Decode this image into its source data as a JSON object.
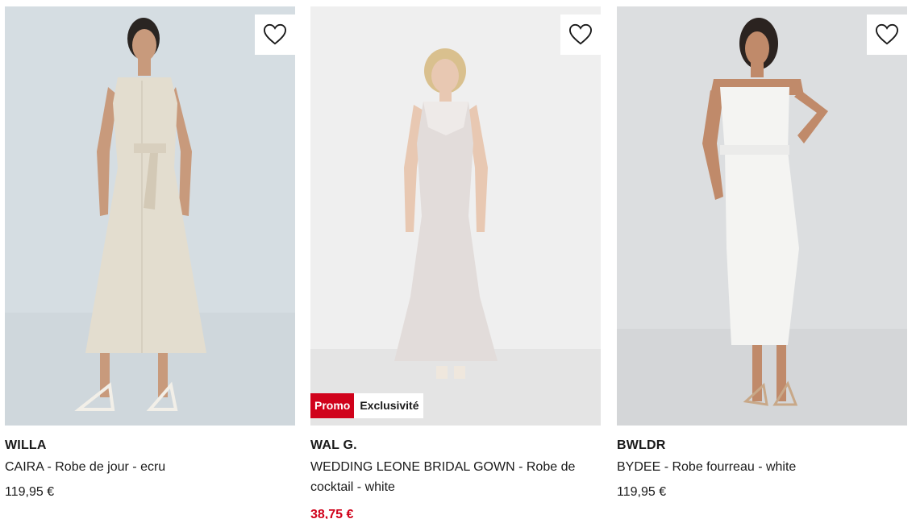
{
  "products": [
    {
      "brand": "WILLA",
      "name": "CAIRA - Robe de jour - ecru",
      "price": "119,95 €",
      "wishlist_icon": "heart-outline-icon"
    },
    {
      "brand": "WAL G.",
      "name": "WEDDING LEONE BRIDAL GOWN - Robe de cocktail - white",
      "price": "38,75 €",
      "badges": {
        "promo": "Promo",
        "exclusive": "Exclusivité"
      },
      "wishlist_icon": "heart-outline-icon"
    },
    {
      "brand": "BWLDR",
      "name": "BYDEE - Robe fourreau - white",
      "price": "119,95 €",
      "wishlist_icon": "heart-outline-icon"
    }
  ],
  "colors": {
    "promo_red": "#d0021b",
    "text": "#1a1a1a",
    "bg_photo_1": "#d5dde2",
    "bg_photo_2": "#efefef",
    "bg_photo_3": "#dcdee0"
  }
}
